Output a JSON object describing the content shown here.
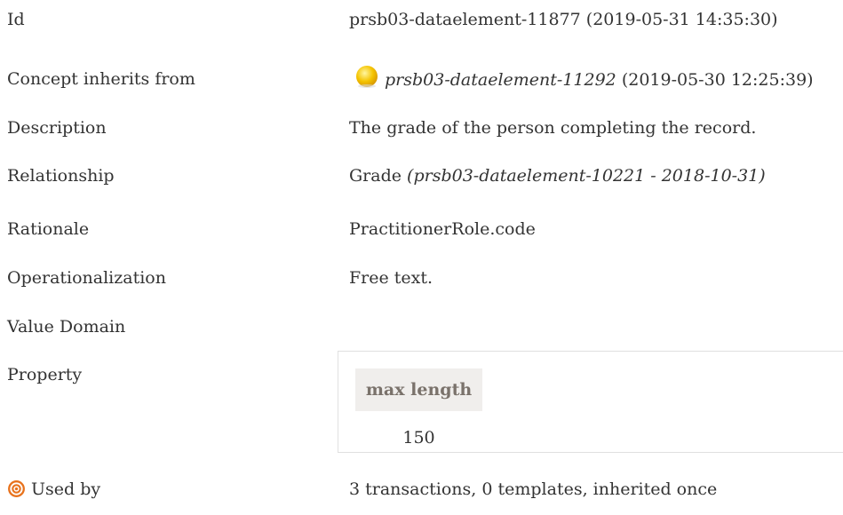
{
  "rows": {
    "id": {
      "label": "Id",
      "value": "prsb03-dataelement-11877 (2019-05-31 14:35:30)"
    },
    "concept_inherits_from": {
      "label": "Concept inherits from",
      "link": "prsb03-dataelement-11292",
      "date": " (2019-05-30 12:25:39)",
      "icon": "yellow-circle-icon"
    },
    "description": {
      "label": "Description",
      "value": "The grade of the person completing the record."
    },
    "relationship": {
      "label": "Relationship",
      "name": "Grade",
      "ref": " (prsb03-dataelement-10221 - 2018-10-31)"
    },
    "rationale": {
      "label": "Rationale",
      "value": "PractitionerRole.code"
    },
    "operationalization": {
      "label": "Operationalization",
      "value": "Free text."
    },
    "value_domain": {
      "label": "Value Domain"
    },
    "property": {
      "label": "Property",
      "header": "max length",
      "value": "150"
    },
    "used_by": {
      "label": "Used by",
      "value": "3 transactions, 0 templates, inherited once",
      "icon": "target-icon"
    }
  },
  "colors": {
    "text": "#333333",
    "property_header_bg": "#f0eeec",
    "property_header_text": "#7a726b",
    "box_border": "#e0e0e0",
    "concept_dot": "#f5c400",
    "used_icon": "#e8721c"
  }
}
